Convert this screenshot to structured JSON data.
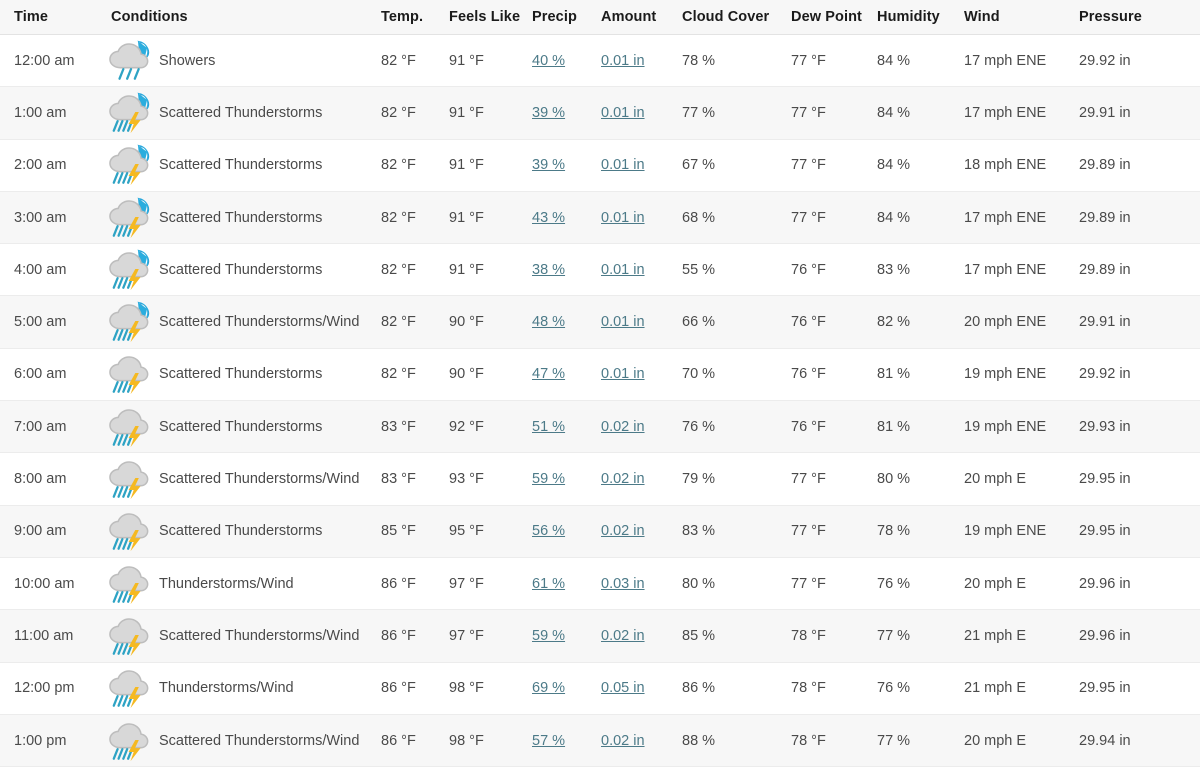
{
  "table": {
    "columns": [
      {
        "key": "time",
        "label": "Time"
      },
      {
        "key": "cond",
        "label": "Conditions"
      },
      {
        "key": "temp",
        "label": "Temp."
      },
      {
        "key": "feels",
        "label": "Feels Like"
      },
      {
        "key": "precip",
        "label": "Precip"
      },
      {
        "key": "amount",
        "label": "Amount"
      },
      {
        "key": "cloud",
        "label": "Cloud Cover"
      },
      {
        "key": "dew",
        "label": "Dew Point"
      },
      {
        "key": "humidity",
        "label": "Humidity"
      },
      {
        "key": "wind",
        "label": "Wind"
      },
      {
        "key": "pressure",
        "label": "Pressure"
      }
    ],
    "colors": {
      "header_bg": "#f7f7f7",
      "row_alt_bg": "#f7f7f7",
      "row_bg": "#ffffff",
      "text": "#4a4a4a",
      "header_text": "#1b1b1b",
      "link": "#4c7a88",
      "row_border": "#ececec",
      "icon_cloud": "#d8d8d8",
      "icon_cloud_outline": "#bdbdbd",
      "icon_rain": "#2ea3c4",
      "icon_bolt": "#f5b921",
      "icon_moon": "#2b9fd8"
    },
    "rows": [
      {
        "time": "12:00 am",
        "icon": "showers-night-icon",
        "icon_kind": "showers",
        "night": true,
        "cond": "Showers",
        "temp": "82 °F",
        "feels": "91 °F",
        "precip": "40 %",
        "amount": "0.01 in",
        "cloud": "78 %",
        "dew": "77 °F",
        "humidity": "84 %",
        "wind": "17 mph ENE",
        "pressure": "29.92 in"
      },
      {
        "time": "1:00 am",
        "icon": "scattered-thunderstorms-night-icon",
        "icon_kind": "tstorm",
        "night": true,
        "cond": "Scattered Thunderstorms",
        "temp": "82 °F",
        "feels": "91 °F",
        "precip": "39 %",
        "amount": "0.01 in",
        "cloud": "77 %",
        "dew": "77 °F",
        "humidity": "84 %",
        "wind": "17 mph ENE",
        "pressure": "29.91 in"
      },
      {
        "time": "2:00 am",
        "icon": "scattered-thunderstorms-night-icon",
        "icon_kind": "tstorm",
        "night": true,
        "cond": "Scattered Thunderstorms",
        "temp": "82 °F",
        "feels": "91 °F",
        "precip": "39 %",
        "amount": "0.01 in",
        "cloud": "67 %",
        "dew": "77 °F",
        "humidity": "84 %",
        "wind": "18 mph ENE",
        "pressure": "29.89 in"
      },
      {
        "time": "3:00 am",
        "icon": "scattered-thunderstorms-night-icon",
        "icon_kind": "tstorm",
        "night": true,
        "cond": "Scattered Thunderstorms",
        "temp": "82 °F",
        "feels": "91 °F",
        "precip": "43 %",
        "amount": "0.01 in",
        "cloud": "68 %",
        "dew": "77 °F",
        "humidity": "84 %",
        "wind": "17 mph ENE",
        "pressure": "29.89 in"
      },
      {
        "time": "4:00 am",
        "icon": "scattered-thunderstorms-night-icon",
        "icon_kind": "tstorm",
        "night": true,
        "cond": "Scattered Thunderstorms",
        "temp": "82 °F",
        "feels": "91 °F",
        "precip": "38 %",
        "amount": "0.01 in",
        "cloud": "55 %",
        "dew": "76 °F",
        "humidity": "83 %",
        "wind": "17 mph ENE",
        "pressure": "29.89 in"
      },
      {
        "time": "5:00 am",
        "icon": "scattered-thunderstorms-night-icon",
        "icon_kind": "tstorm",
        "night": true,
        "cond": "Scattered Thunderstorms/Wind",
        "temp": "82 °F",
        "feels": "90 °F",
        "precip": "48 %",
        "amount": "0.01 in",
        "cloud": "66 %",
        "dew": "76 °F",
        "humidity": "82 %",
        "wind": "20 mph ENE",
        "pressure": "29.91 in"
      },
      {
        "time": "6:00 am",
        "icon": "scattered-thunderstorms-icon",
        "icon_kind": "tstorm",
        "night": false,
        "cond": "Scattered Thunderstorms",
        "temp": "82 °F",
        "feels": "90 °F",
        "precip": "47 %",
        "amount": "0.01 in",
        "cloud": "70 %",
        "dew": "76 °F",
        "humidity": "81 %",
        "wind": "19 mph ENE",
        "pressure": "29.92 in"
      },
      {
        "time": "7:00 am",
        "icon": "scattered-thunderstorms-icon",
        "icon_kind": "tstorm",
        "night": false,
        "cond": "Scattered Thunderstorms",
        "temp": "83 °F",
        "feels": "92 °F",
        "precip": "51 %",
        "amount": "0.02 in",
        "cloud": "76 %",
        "dew": "76 °F",
        "humidity": "81 %",
        "wind": "19 mph ENE",
        "pressure": "29.93 in"
      },
      {
        "time": "8:00 am",
        "icon": "scattered-thunderstorms-icon",
        "icon_kind": "tstorm",
        "night": false,
        "cond": "Scattered Thunderstorms/Wind",
        "temp": "83 °F",
        "feels": "93 °F",
        "precip": "59 %",
        "amount": "0.02 in",
        "cloud": "79 %",
        "dew": "77 °F",
        "humidity": "80 %",
        "wind": "20 mph E",
        "pressure": "29.95 in"
      },
      {
        "time": "9:00 am",
        "icon": "scattered-thunderstorms-icon",
        "icon_kind": "tstorm",
        "night": false,
        "cond": "Scattered Thunderstorms",
        "temp": "85 °F",
        "feels": "95 °F",
        "precip": "56 %",
        "amount": "0.02 in",
        "cloud": "83 %",
        "dew": "77 °F",
        "humidity": "78 %",
        "wind": "19 mph ENE",
        "pressure": "29.95 in"
      },
      {
        "time": "10:00 am",
        "icon": "thunderstorms-wind-icon",
        "icon_kind": "tstorm",
        "night": false,
        "cond": "Thunderstorms/Wind",
        "temp": "86 °F",
        "feels": "97 °F",
        "precip": "61 %",
        "amount": "0.03 in",
        "cloud": "80 %",
        "dew": "77 °F",
        "humidity": "76 %",
        "wind": "20 mph E",
        "pressure": "29.96 in"
      },
      {
        "time": "11:00 am",
        "icon": "scattered-thunderstorms-icon",
        "icon_kind": "tstorm",
        "night": false,
        "cond": "Scattered Thunderstorms/Wind",
        "temp": "86 °F",
        "feels": "97 °F",
        "precip": "59 %",
        "amount": "0.02 in",
        "cloud": "85 %",
        "dew": "78 °F",
        "humidity": "77 %",
        "wind": "21 mph E",
        "pressure": "29.96 in"
      },
      {
        "time": "12:00 pm",
        "icon": "thunderstorms-wind-icon",
        "icon_kind": "tstorm",
        "night": false,
        "cond": "Thunderstorms/Wind",
        "temp": "86 °F",
        "feels": "98 °F",
        "precip": "69 %",
        "amount": "0.05 in",
        "cloud": "86 %",
        "dew": "78 °F",
        "humidity": "76 %",
        "wind": "21 mph E",
        "pressure": "29.95 in"
      },
      {
        "time": "1:00 pm",
        "icon": "scattered-thunderstorms-icon",
        "icon_kind": "tstorm",
        "night": false,
        "cond": "Scattered Thunderstorms/Wind",
        "temp": "86 °F",
        "feels": "98 °F",
        "precip": "57 %",
        "amount": "0.02 in",
        "cloud": "88 %",
        "dew": "78 °F",
        "humidity": "77 %",
        "wind": "20 mph E",
        "pressure": "29.94 in"
      }
    ]
  }
}
